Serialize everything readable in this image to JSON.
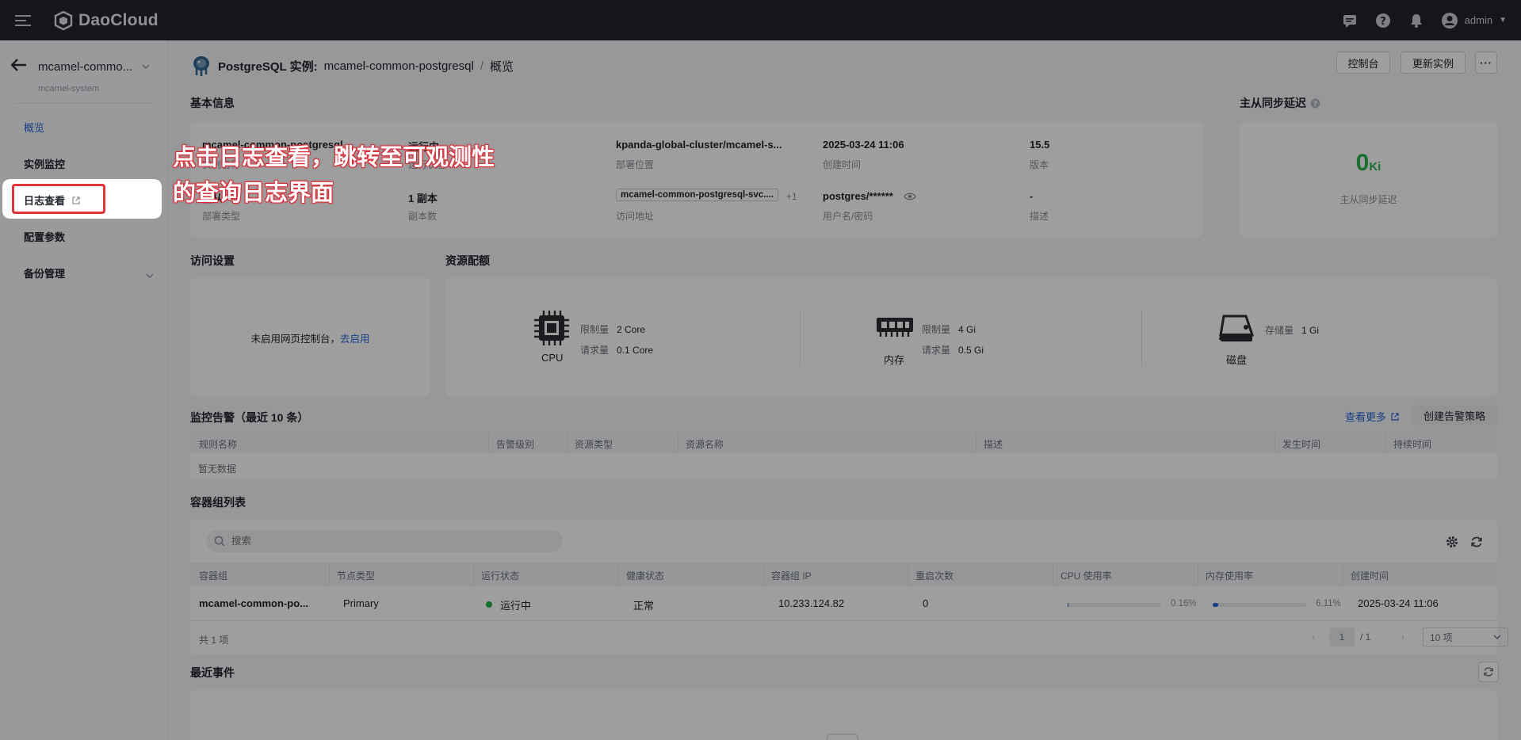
{
  "topbar": {
    "logo_text": "DaoCloud",
    "user": "admin",
    "icons": [
      "message-icon",
      "help-icon",
      "bell-icon",
      "user-avatar-icon"
    ]
  },
  "sidebar": {
    "instance_name": "mcamel-commo...",
    "namespace": "mcamel-system",
    "items": [
      {
        "label": "概览"
      },
      {
        "label": "实例监控"
      },
      {
        "label": "日志查看"
      },
      {
        "label": "配置参数"
      },
      {
        "label": "备份管理"
      }
    ]
  },
  "header": {
    "kind": "PostgreSQL 实例:",
    "instance": "mcamel-common-postgresql",
    "sep": "/",
    "page": "概览",
    "console_btn": "控制台",
    "update_btn": "更新实例",
    "more_btn": "···"
  },
  "basic_info": {
    "title": "基本信息",
    "r1": [
      {
        "value": "mcamel-common-postgresql",
        "label": "实例名称"
      },
      {
        "value": "运行中",
        "label": "运行状态"
      },
      {
        "value": "kpanda-global-cluster/mcamel-s...",
        "label": "部署位置"
      },
      {
        "value": "2025-03-24 11:06",
        "label": "创建时间"
      },
      {
        "value": "15.5",
        "label": "版本"
      }
    ],
    "r2": [
      {
        "value": "主从",
        "label": "部署类型"
      },
      {
        "value": "1 副本",
        "label": "副本数"
      },
      {
        "value": "mcamel-common-postgresql-svc....",
        "extra": "+1",
        "label": "访问地址"
      },
      {
        "value": "postgres/******",
        "label": "用户名/密码"
      },
      {
        "value": "-",
        "label": "描述"
      }
    ]
  },
  "sync_delay": {
    "title": "主从同步延迟",
    "value": "0",
    "unit": "Ki",
    "label": "主从同步延迟"
  },
  "access": {
    "title": "访问设置",
    "text": "未启用网页控制台，",
    "link": "去启用"
  },
  "resources": {
    "title": "资源配额",
    "cpu": {
      "name": "CPU",
      "limit_label": "限制量",
      "limit": "2 Core",
      "req_label": "请求量",
      "req": "0.1 Core"
    },
    "mem": {
      "name": "内存",
      "limit_label": "限制量",
      "limit": "4 Gi",
      "req_label": "请求量",
      "req": "0.5 Gi"
    },
    "disk": {
      "name": "磁盘",
      "storage_label": "存储量",
      "storage": "1 Gi"
    }
  },
  "alerts": {
    "title": "监控告警（最近 10 条）",
    "more_link": "查看更多",
    "create_btn": "创建告警策略",
    "columns": [
      "规则名称",
      "告警级别",
      "资源类型",
      "资源名称",
      "描述",
      "发生时间",
      "持续时间"
    ],
    "empty": "暂无数据"
  },
  "pods": {
    "title": "容器组列表",
    "search_placeholder": "搜索",
    "columns": [
      "容器组",
      "节点类型",
      "运行状态",
      "健康状态",
      "容器组 IP",
      "重启次数",
      "CPU 使用率",
      "内存使用率",
      "创建时间"
    ],
    "rows": [
      {
        "name": "mcamel-common-po...",
        "node_type": "Primary",
        "status": "运行中",
        "health": "正常",
        "ip": "10.233.124.82",
        "restarts": "0",
        "cpu_pct": "0.16%",
        "cpu_frac": 0.0016,
        "mem_pct": "6.11%",
        "mem_frac": 0.0611,
        "created": "2025-03-24 11:06"
      }
    ],
    "total": "共 1 项",
    "page": "1",
    "page_total": "/ 1",
    "page_size": "10 项"
  },
  "events": {
    "title": "最近事件"
  },
  "annotation": {
    "line1": "点击日志查看，跳转至可观测性",
    "line2": "的查询日志界面"
  }
}
